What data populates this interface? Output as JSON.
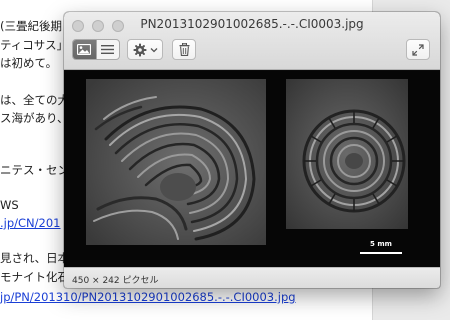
{
  "document": {
    "lines": [
      "(三畳紀後期",
      "ティコサス」",
      "は初めて。",
      "は、全ての大",
      "ス海があり、",
      "ニテス・セン",
      "WS",
      ".jp/CN/201",
      "見され、日本",
      "モナイト化石",
      "jp/PN/201310/PN2013102901002685.-.-.CI0003.jpg"
    ]
  },
  "window": {
    "title": "PN2013102901002685.-.-.CI0003.jpg",
    "toolbar": {
      "view_thumbnail_icon": "image-view-icon",
      "view_list_icon": "list-view-icon",
      "action_icon": "gear-icon",
      "action_menu_icon": "chevron-down-icon",
      "delete_icon": "trash-icon",
      "fullscreen_icon": "expand-arrows-icon"
    },
    "image": {
      "scale_label": "5 mm"
    },
    "status": "450 × 242 ピクセル"
  }
}
